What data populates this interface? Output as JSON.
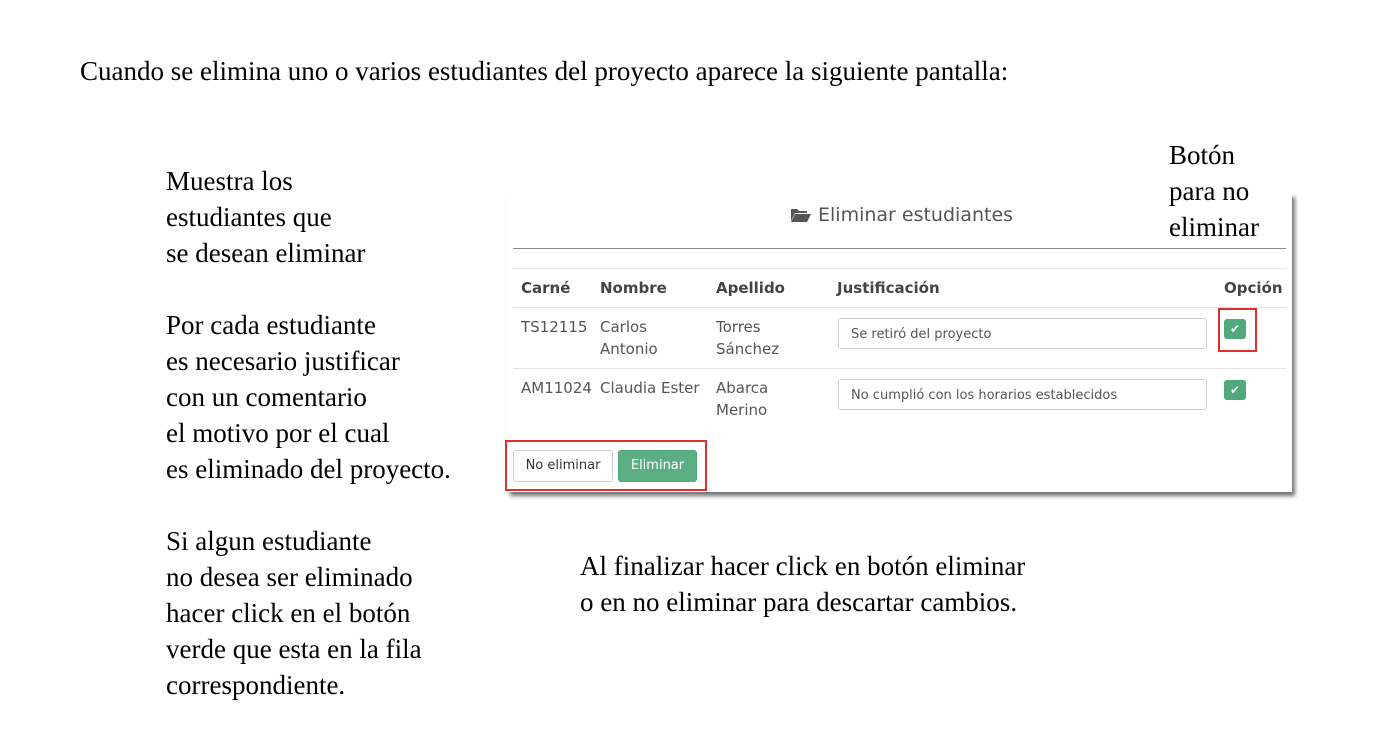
{
  "intro": "Cuando se elimina uno o varios estudiantes del proyecto aparece la siguiente pantalla:",
  "left_notes": {
    "block1": [
      "Muestra los",
      "estudiantes que",
      "se desean eliminar"
    ],
    "block2": [
      "Por cada estudiante",
      "es necesario justificar",
      "con un comentario",
      "el motivo por el cual",
      "es eliminado del proyecto."
    ],
    "block3": [
      "Si algun estudiante",
      "no desea ser eliminado",
      "hacer click en el botón",
      "verde que esta en la fila",
      "correspondiente."
    ]
  },
  "side_note": [
    "Botón",
    "para no",
    "eliminar"
  ],
  "bottom_note": [
    "Al finalizar hacer click en botón eliminar",
    "o en no eliminar para descartar cambios."
  ],
  "panel": {
    "title": "Eliminar estudiantes",
    "title_icon": "folder-open-icon",
    "columns": [
      "Carné",
      "Nombre",
      "Apellido",
      "Justificación",
      "Opción"
    ],
    "rows": [
      {
        "carne": "TS12115",
        "nombre": [
          "Carlos",
          "Antonio"
        ],
        "apellido": [
          "Torres",
          "Sánchez"
        ],
        "justificacion": "Se retiró del proyecto",
        "option_icon": "check-icon"
      },
      {
        "carne": "AM11024",
        "nombre": [
          "Claudia Ester"
        ],
        "apellido": [
          "Abarca",
          "Merino"
        ],
        "justificacion": "No cumplió con los horarios establecidos",
        "option_icon": "check-icon"
      }
    ],
    "buttons": {
      "cancel": "No eliminar",
      "confirm": "Eliminar"
    }
  },
  "colors": {
    "accent_green": "#5aae82",
    "highlight_red": "#e0302e"
  }
}
